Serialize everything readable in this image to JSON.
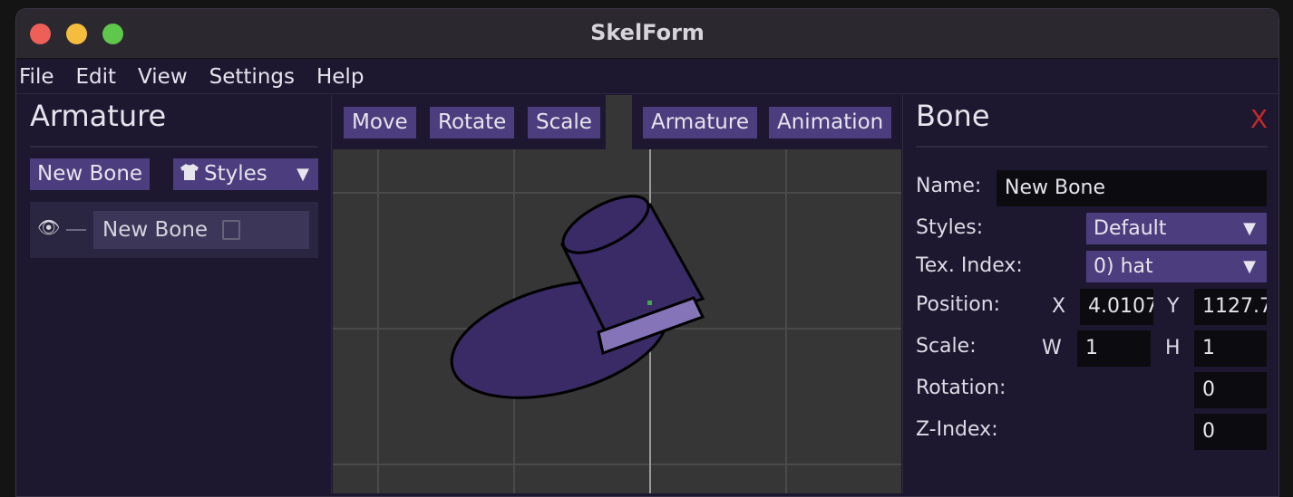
{
  "window": {
    "title": "SkelForm"
  },
  "menu": [
    "File",
    "Edit",
    "View",
    "Settings",
    "Help"
  ],
  "armature_panel": {
    "title": "Armature",
    "new_bone_label": "New Bone",
    "styles_label": "Styles",
    "bones": [
      {
        "name": "New Bone"
      }
    ]
  },
  "toolbar": {
    "move": "Move",
    "rotate": "Rotate",
    "scale": "Scale",
    "armature": "Armature",
    "animation": "Animation"
  },
  "bone_panel": {
    "title": "Bone",
    "close": "X",
    "name_label": "Name:",
    "name_value": "New Bone",
    "styles_label": "Styles:",
    "styles_value": "Default",
    "tex_index_label": "Tex. Index:",
    "tex_index_value": "0) hat",
    "position_label": "Position:",
    "x_label": "X",
    "x_value": "4.0107",
    "y_label": "Y",
    "y_value": "1127.7",
    "scale_label": "Scale:",
    "w_label": "W",
    "w_value": "1",
    "h_label": "H",
    "h_value": "1",
    "rotation_label": "Rotation:",
    "rotation_value": "0",
    "zindex_label": "Z-Index:",
    "zindex_value": "0"
  },
  "colors": {
    "accent": "#4b3d7e",
    "panel_bg": "#1d1830",
    "viewport_bg": "#363636",
    "hat": "#3a2a66",
    "hat_band": "#8574b8",
    "close": "#c42a2a"
  },
  "icons": {
    "eye": "eye-icon",
    "shirt": "shirt-icon",
    "texture": "image-icon",
    "dropdown": "chevron-down-icon"
  }
}
